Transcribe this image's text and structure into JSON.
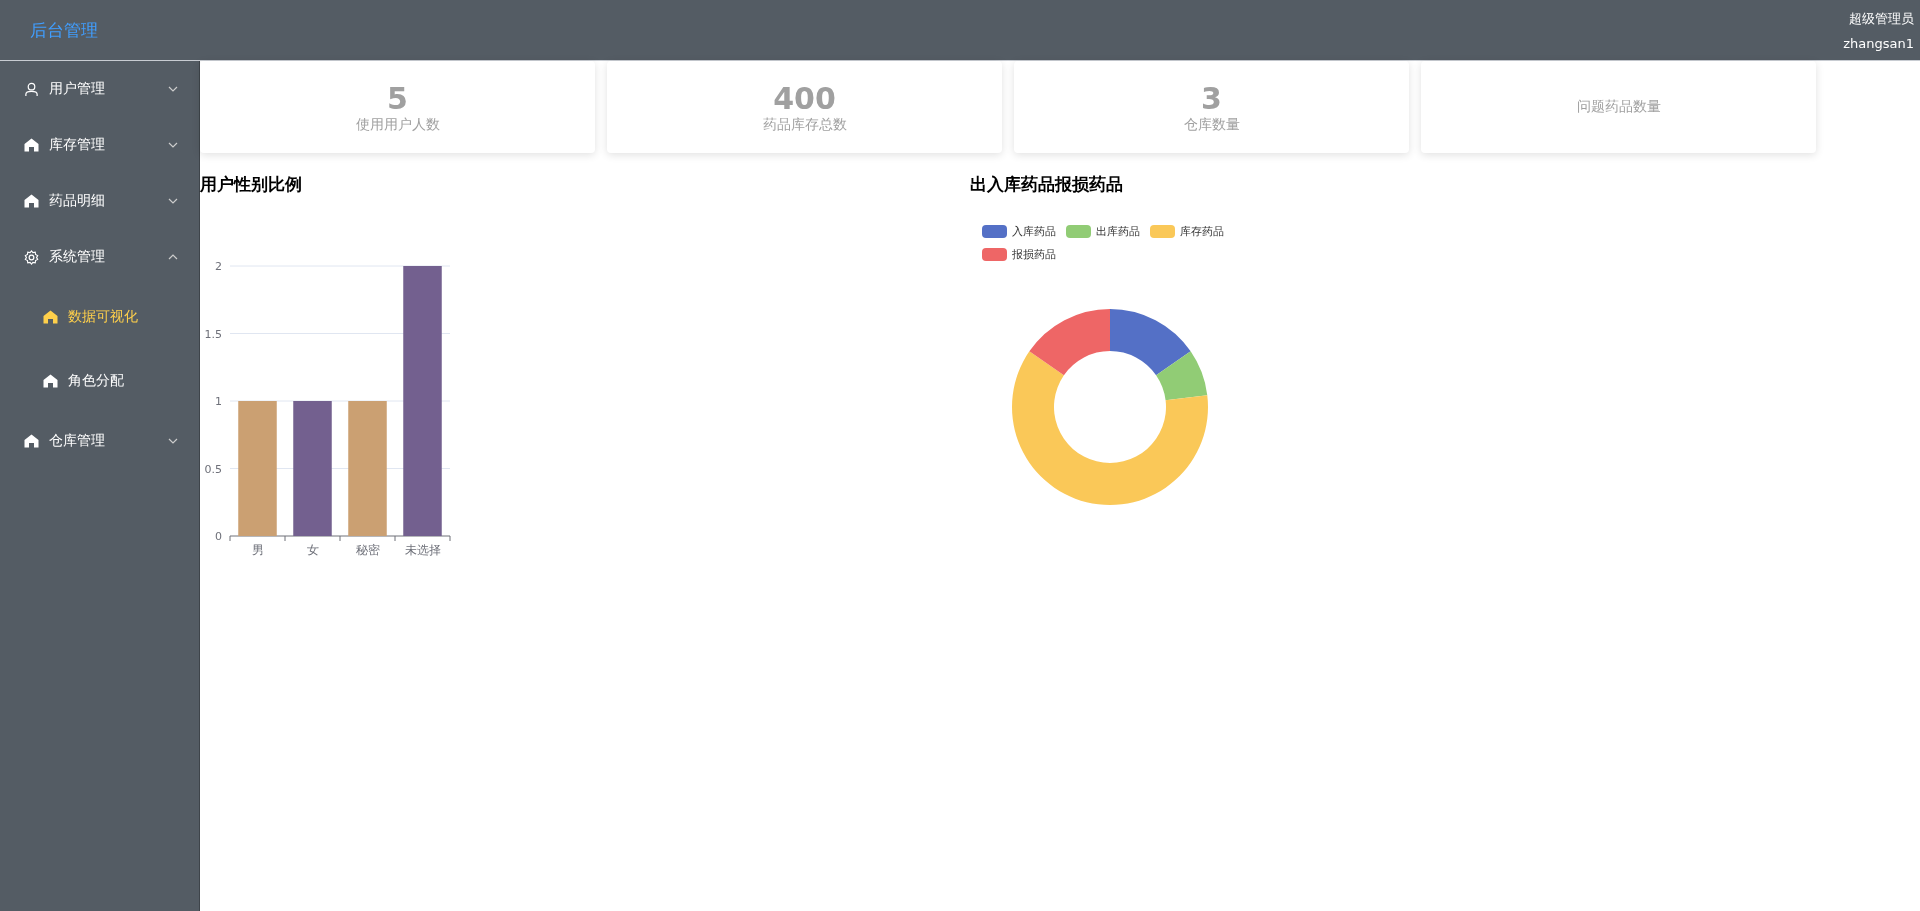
{
  "header": {
    "logo": "后台管理",
    "role": "超级管理员",
    "username": "zhangsan1"
  },
  "sidebar": {
    "items": [
      {
        "label": "用户管理",
        "kind": "user",
        "expanded": false
      },
      {
        "label": "库存管理",
        "kind": "home",
        "expanded": false
      },
      {
        "label": "药品明细",
        "kind": "home",
        "expanded": false
      },
      {
        "label": "系统管理",
        "kind": "gear",
        "expanded": true,
        "children": [
          {
            "label": "数据可视化",
            "kind": "home",
            "selected": true
          },
          {
            "label": "角色分配",
            "kind": "home",
            "selected": false
          }
        ]
      },
      {
        "label": "仓库管理",
        "kind": "home",
        "expanded": false
      }
    ]
  },
  "stats": [
    {
      "value": "5",
      "label": "使用用户人数"
    },
    {
      "value": "400",
      "label": "药品库存总数"
    },
    {
      "value": "3",
      "label": "仓库数量"
    },
    {
      "label": "问题药品数量"
    }
  ],
  "gender_chart": {
    "title": "用户性别比例",
    "chart_data": {
      "type": "bar",
      "categories": [
        "男",
        "女",
        "秘密",
        "未选择"
      ],
      "values": [
        1,
        1,
        1,
        2
      ],
      "grid": true,
      "colors": [
        "#cba072",
        "#73608f",
        "#cba072",
        "#73608f"
      ],
      "ylim": [
        0,
        2
      ],
      "yticks": [
        0,
        {
          "value": 0.5,
          "label": "0.5"
        },
        1,
        {
          "value": 1.5,
          "label": "1.5"
        },
        2
      ]
    }
  },
  "stock_chart": {
    "title": "出入库药品报损药品",
    "legend": [
      {
        "label": "入库药品",
        "color": "#5470c6"
      },
      {
        "label": "出库药品",
        "color": "#91cc75"
      },
      {
        "label": "库存药品",
        "color": "#fac858"
      },
      {
        "label": "报损药品",
        "color": "#ee6666"
      }
    ]
  }
}
